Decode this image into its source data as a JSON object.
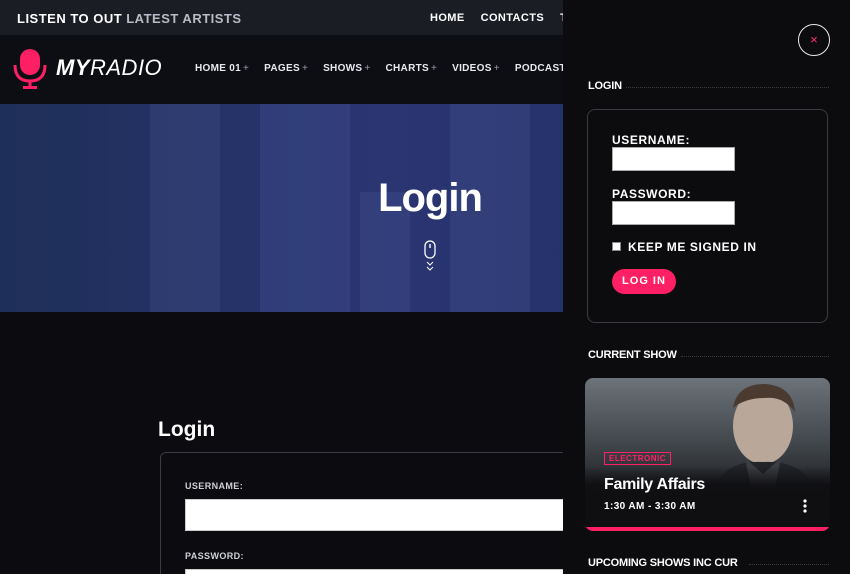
{
  "topbar": {
    "tagline_bold": "LISTEN TO OUT",
    "tagline_dim": "LATEST ARTISTS",
    "links": [
      "HOME",
      "CONTACTS",
      "TE"
    ]
  },
  "brand": {
    "name_bold": "MY",
    "name_rest": "RADIO"
  },
  "nav": {
    "items": [
      "HOME 01",
      "PAGES",
      "SHOWS",
      "CHARTS",
      "VIDEOS",
      "PODCASTS"
    ],
    "plus": "+"
  },
  "hero": {
    "title": "Login"
  },
  "content": {
    "title": "Login",
    "username_label": "USERNAME:",
    "password_label": "PASSWORD:"
  },
  "panel": {
    "close": "×",
    "login_section": "LOGIN",
    "username_label": "USERNAME:",
    "password_label": "PASSWORD:",
    "remember_label": "KEEP ME SIGNED IN",
    "login_button": "LOG IN",
    "current_show_section": "CURRENT SHOW",
    "show": {
      "genre": "ELECTRONIC",
      "name": "Family Affairs",
      "time": "1:30 AM - 3:30 AM"
    },
    "upcoming_section": "UPCOMING SHOWS INC CUR"
  },
  "colors": {
    "accent": "#ff1f64",
    "panel_bg": "#0c0c0f",
    "hero": "#2a3572"
  },
  "icons": {
    "logo": "microphone-icon",
    "scroll": "mouse-scroll-icon",
    "close": "close-icon",
    "menu": "kebab-menu-icon"
  }
}
